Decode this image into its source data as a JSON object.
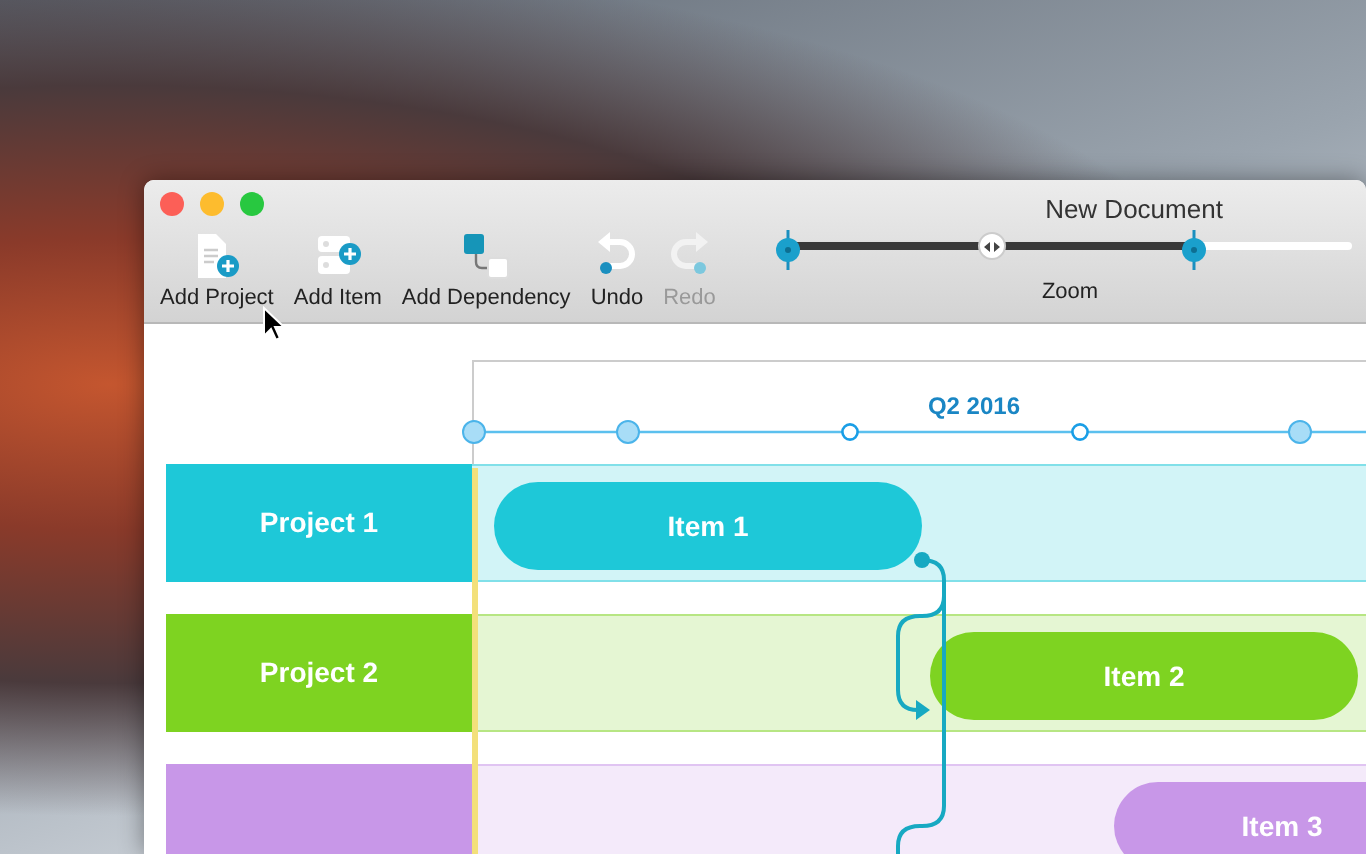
{
  "window": {
    "title": "New Document"
  },
  "toolbar": {
    "buttons": [
      {
        "label": "Add Project",
        "kind": "add-project",
        "disabled": false
      },
      {
        "label": "Add Item",
        "kind": "add-item",
        "disabled": false
      },
      {
        "label": "Add Dependency",
        "kind": "add-dependency",
        "disabled": false
      },
      {
        "label": "Undo",
        "kind": "undo",
        "disabled": false
      },
      {
        "label": "Redo",
        "kind": "redo",
        "disabled": true
      }
    ],
    "zoom": {
      "label": "Zoom",
      "level": 0.72
    }
  },
  "timeline": {
    "period": "Q2 2016"
  },
  "projects": [
    {
      "name": "Project 1",
      "color": "#1ec8d8",
      "items": [
        {
          "label": "Item 1"
        }
      ]
    },
    {
      "name": "Project 2",
      "color": "#7ed321",
      "items": [
        {
          "label": "Item 2"
        }
      ]
    },
    {
      "color": "#c897e8",
      "items": [
        {
          "label": "Item 3"
        }
      ]
    }
  ]
}
